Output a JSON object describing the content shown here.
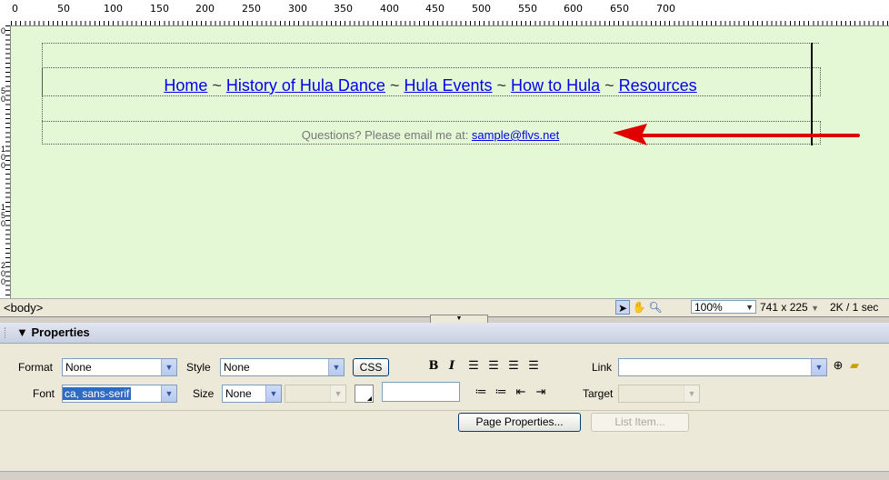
{
  "ruler": {
    "top_labels": [
      "0",
      "50",
      "100",
      "150",
      "200",
      "250",
      "300",
      "350",
      "400",
      "450",
      "500",
      "550",
      "600",
      "650",
      "700"
    ],
    "left_labels": [
      "0",
      "50",
      "100",
      "150",
      "200"
    ]
  },
  "page": {
    "nav": {
      "home": "Home",
      "history": "History of Hula Dance",
      "events": "Hula Events",
      "howto": "How to Hula",
      "resources": "Resources",
      "sep": " ~ "
    },
    "footer": {
      "text": "Questions? Please email me at: ",
      "email": "sample@flvs.net"
    }
  },
  "status": {
    "tag": "<body>",
    "zoom": "100%",
    "window_size": "741 x 225",
    "download": "2K / 1 sec"
  },
  "properties": {
    "title": "Properties",
    "format_label": "Format",
    "format_value": "None",
    "style_label": "Style",
    "style_value": "None",
    "css_label": "CSS",
    "font_label": "Font",
    "font_value": "ca, sans-serif",
    "size_label": "Size",
    "size_value": "None",
    "link_label": "Link",
    "target_label": "Target",
    "bold": "B",
    "italic": "I",
    "page_properties": "Page Properties...",
    "list_item": "List Item..."
  },
  "colors": {
    "canvas_bg": "#e5f8d6",
    "link": "#0000ee",
    "arrow": "#e00000",
    "panel_bg": "#ece9d8"
  }
}
